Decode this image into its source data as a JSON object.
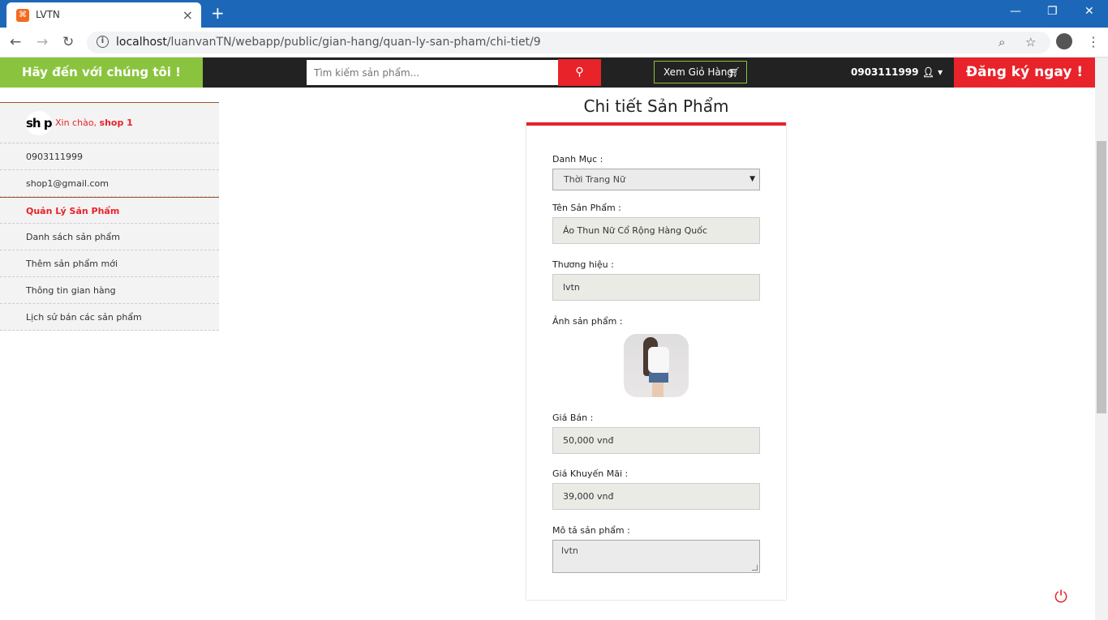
{
  "browser": {
    "tab_title": "LVTN",
    "url_host": "localhost",
    "url_path": "/luanvanTN/webapp/public/gian-hang/quan-ly-san-pham/chi-tiet/9"
  },
  "header": {
    "welcome": "Hãy đến với chúng tôi !",
    "search_placeholder": "Tìm kiếm sản phẩm...",
    "cart_label": "Xem Giỏ Hàng",
    "account_phone": "0903111999",
    "register_label": "Đăng ký ngay !"
  },
  "sidebar": {
    "logo_text": "sh p",
    "greeting": "Xin chào, ",
    "shop_name": "shop 1",
    "phone": "0903111999",
    "email": "shop1@gmail.com",
    "section_title": "Quản Lý Sản Phẩm",
    "items": [
      {
        "label": "Danh sách sản phẩm"
      },
      {
        "label": "Thêm sản phẩm mới"
      },
      {
        "label": "Thông tin gian hàng"
      },
      {
        "label": "Lịch sử bán các sản phẩm"
      }
    ]
  },
  "form": {
    "title": "Chi tiết Sản Phẩm",
    "category_label": "Danh Mục :",
    "category_value": "Thời Trang Nữ",
    "name_label": "Tên Sản Phẩm :",
    "name_value": "Áo Thun Nữ Cổ Rộng Hàng Quốc",
    "brand_label": "Thương hiệu :",
    "brand_value": "lvtn",
    "image_label": "Ảnh sản phẩm :",
    "price_label": "Giá Bán :",
    "price_value": "50,000 vnđ",
    "sale_price_label": "Giá Khuyến Mãi :",
    "sale_price_value": "39,000 vnđ",
    "description_label": "Mô tả sản phẩm :",
    "description_value": "lvtn"
  },
  "colors": {
    "accent_green": "#8ac43e",
    "accent_red": "#e8232a",
    "header_dark": "#222222",
    "browser_blue": "#1c67b8"
  }
}
